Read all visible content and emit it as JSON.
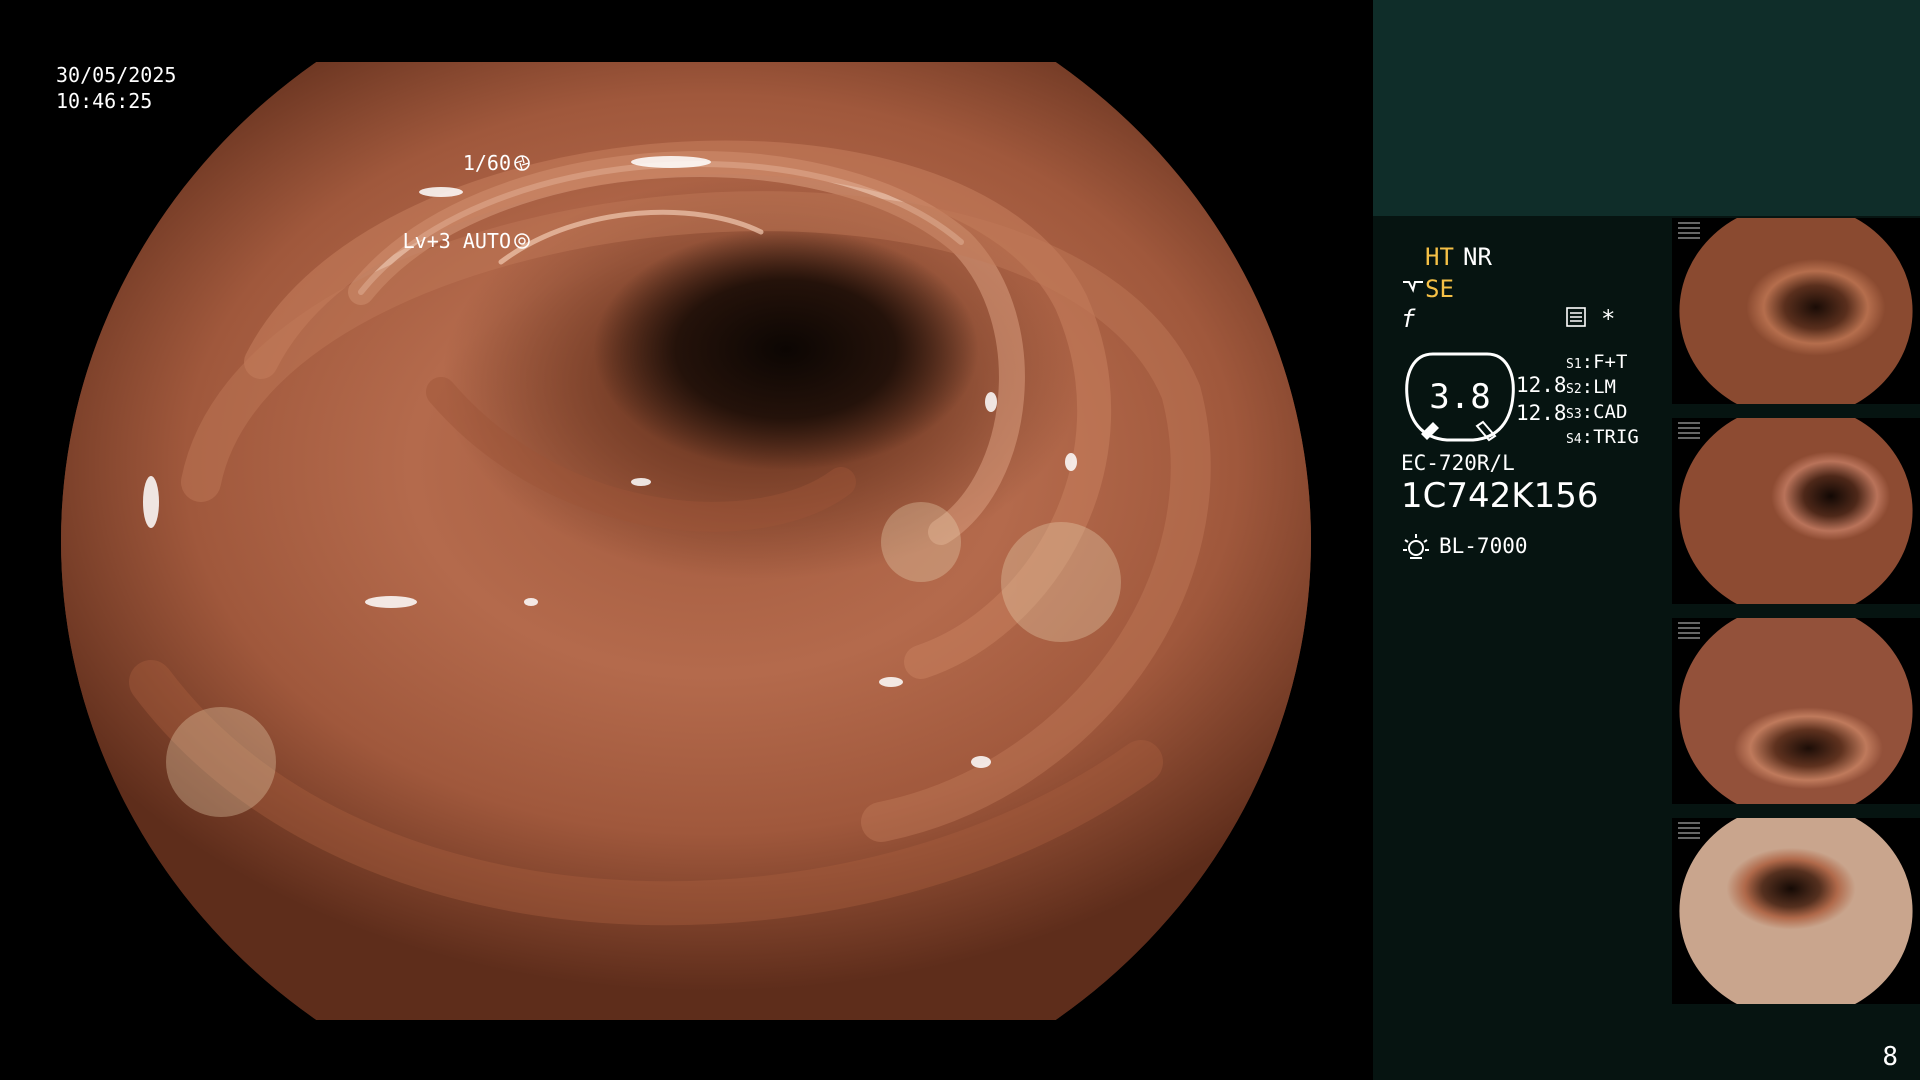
{
  "screen": {
    "date": "30/05/2025",
    "time": "10:46:25",
    "shutter": "1/60",
    "exposure": "Lv+3 AUTO"
  },
  "panel": {
    "ht": "HT",
    "nr": "NR",
    "se": "SE",
    "gauge_value": "3.8",
    "gauge_right_1": "12.8",
    "gauge_right_2": "12.8",
    "switches": [
      {
        "key": "S1",
        "label": "F+T"
      },
      {
        "key": "S2",
        "label": "LM"
      },
      {
        "key": "S3",
        "label": "CAD"
      },
      {
        "key": "S4",
        "label": "TRIG"
      }
    ],
    "scope_model": "EC-720R/L",
    "scope_serial": "1C742K156",
    "light_source": "BL-7000",
    "star": "*",
    "f_symbol": "f"
  },
  "icons": [
    "shutter-icon",
    "auto-iris-icon",
    "structure-enhance-icon",
    "freeze-icon",
    "list-icon",
    "light-source-icon"
  ],
  "colors": {
    "accent": "#f5c046",
    "panel_bg": "#061411",
    "panel_top": "#0f2d29"
  },
  "thumbnails_count": 4,
  "page_number": "8"
}
